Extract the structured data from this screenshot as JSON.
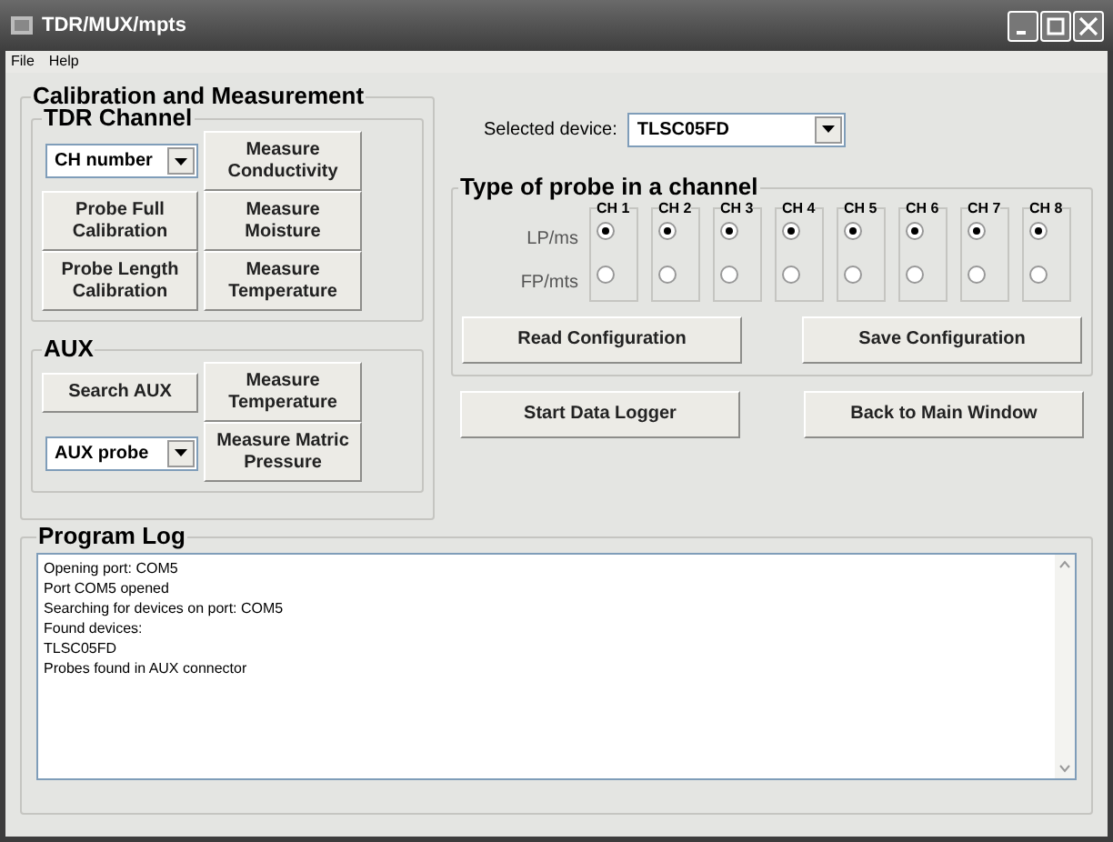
{
  "window": {
    "title": "TDR/MUX/mpts"
  },
  "menu": [
    "File",
    "Help"
  ],
  "calibration": {
    "title": "Calibration and Measurement",
    "tdr_channel": {
      "title": "TDR Channel",
      "select": {
        "value": "CH number"
      },
      "left_buttons": [
        {
          "lines": [
            "Probe Full",
            "Calibration"
          ]
        },
        {
          "lines": [
            "Probe Length",
            "Calibration"
          ]
        }
      ],
      "right_buttons": [
        {
          "lines": [
            "Measure",
            "Conductivity"
          ]
        },
        {
          "lines": [
            "Measure",
            "Moisture"
          ]
        },
        {
          "lines": [
            "Measure",
            "Temperature"
          ]
        }
      ]
    },
    "aux": {
      "title": "AUX",
      "search_button": "Search AUX",
      "select": {
        "value": "AUX probe"
      },
      "right_buttons": [
        {
          "lines": [
            "Measure",
            "Temperature"
          ]
        },
        {
          "lines": [
            "Measure Matric",
            "Pressure"
          ]
        }
      ]
    }
  },
  "device": {
    "label": "Selected device:",
    "value": "TLSC05FD"
  },
  "probe_types": {
    "title": "Type of probe in a channel",
    "row_labels": [
      "LP/ms",
      "FP/mts"
    ],
    "channels": [
      {
        "label": "CH 1",
        "options": [
          {
            "selected": true
          },
          {
            "selected": false
          }
        ]
      },
      {
        "label": "CH 2",
        "options": [
          {
            "selected": true
          },
          {
            "selected": false
          }
        ]
      },
      {
        "label": "CH 3",
        "options": [
          {
            "selected": true
          },
          {
            "selected": false
          }
        ]
      },
      {
        "label": "CH 4",
        "options": [
          {
            "selected": true
          },
          {
            "selected": false
          }
        ]
      },
      {
        "label": "CH 5",
        "options": [
          {
            "selected": true
          },
          {
            "selected": false
          }
        ]
      },
      {
        "label": "CH 6",
        "options": [
          {
            "selected": true
          },
          {
            "selected": false
          }
        ]
      },
      {
        "label": "CH 7",
        "options": [
          {
            "selected": true
          },
          {
            "selected": false
          }
        ]
      },
      {
        "label": "CH 8",
        "options": [
          {
            "selected": true
          },
          {
            "selected": false
          }
        ]
      }
    ],
    "buttons": [
      "Read Configuration",
      "Save Configuration"
    ]
  },
  "actions": [
    "Start Data Logger",
    "Back to Main Window"
  ],
  "log": {
    "title": "Program Log",
    "lines": [
      "Opening port: COM5",
      "Port COM5 opened",
      "Searching for devices on port: COM5",
      "Found devices:",
      "TLSC05FD",
      "Probes found in AUX connector"
    ]
  }
}
